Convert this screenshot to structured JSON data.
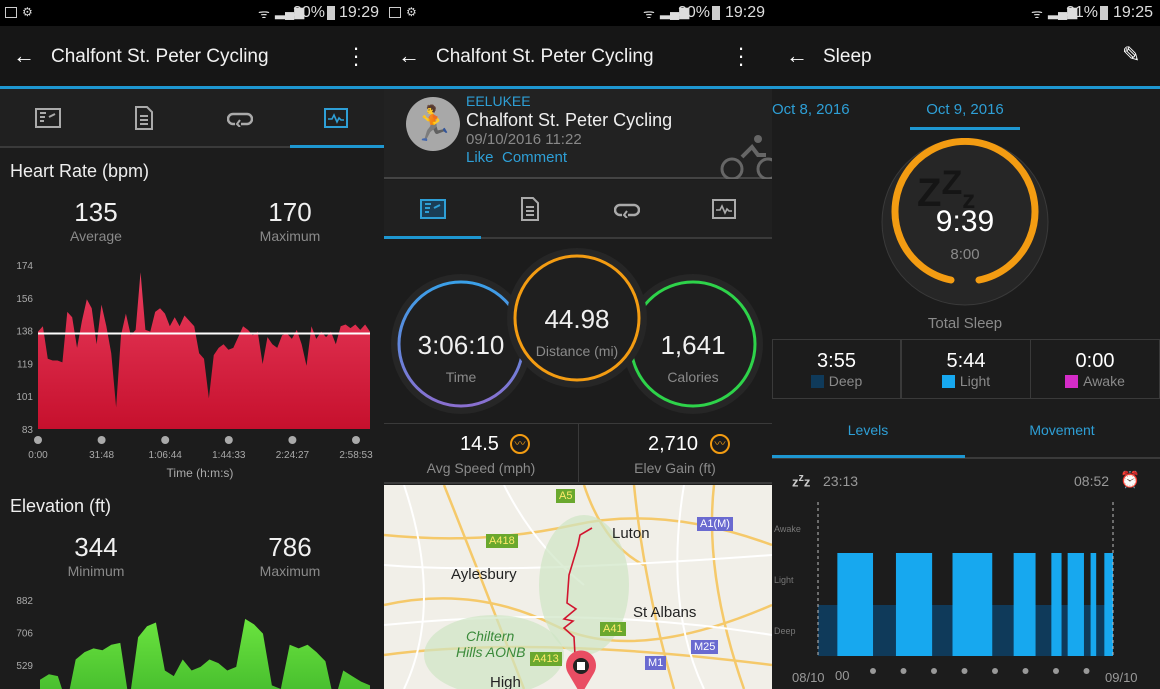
{
  "panel1": {
    "status": {
      "battery": "30%",
      "time": "19:29"
    },
    "title": "Chalfont St. Peter Cycling",
    "tabs": [
      "overview-icon",
      "details-icon",
      "laps-icon",
      "charts-icon"
    ],
    "active_tab": 3,
    "heart": {
      "heading": "Heart Rate (bpm)",
      "avg_value": "135",
      "avg_label": "Average",
      "max_value": "170",
      "max_label": "Maximum"
    },
    "elevation": {
      "heading": "Elevation (ft)",
      "min_value": "344",
      "min_label": "Minimum",
      "max_value": "786",
      "max_label": "Maximum"
    }
  },
  "panel2": {
    "status": {
      "battery": "30%",
      "time": "19:29"
    },
    "title": "Chalfont St. Peter Cycling",
    "user": "EELUKEE",
    "activity": "Chalfont St. Peter Cycling",
    "datetime": "09/10/2016 11:22",
    "like": "Like",
    "comment": "Comment",
    "active_tab": 0,
    "time_value": "3:06:10",
    "time_label": "Time",
    "distance_value": "44.98",
    "distance_label": "Distance (mi)",
    "calories_value": "1,641",
    "calories_label": "Calories",
    "speed_value": "14.5",
    "speed_label": "Avg Speed (mph)",
    "elev_value": "2,710",
    "elev_label": "Elev Gain (ft)",
    "map": {
      "places": [
        "Luton",
        "Aylesbury",
        "St Albans",
        "Chiltern",
        "Hills AONB",
        "High"
      ],
      "roads": [
        "A5",
        "A418",
        "A1(M)",
        "A41",
        "M25",
        "A413",
        "M1"
      ]
    }
  },
  "panel3": {
    "status": {
      "battery": "31%",
      "time": "19:25"
    },
    "title": "Sleep",
    "date_prev": "Oct 8, 2016",
    "date_current": "Oct 9, 2016",
    "total": "9:39",
    "goal": "8:00",
    "total_label": "Total Sleep",
    "deep_value": "3:55",
    "deep_label": "Deep",
    "light_value": "5:44",
    "light_label": "Light",
    "awake_value": "0:00",
    "awake_label": "Awake",
    "tab_levels": "Levels",
    "tab_movement": "Movement",
    "sleep_start": "23:13",
    "sleep_end": "08:52",
    "axis_start": "08/10",
    "axis_mid": "00",
    "axis_end": "09/10"
  },
  "colors": {
    "accent": "#1e97d1",
    "heart": "#e0294f",
    "elevation": "#5fd93a",
    "orange": "#f39c12",
    "deep": "#0f3a5a",
    "light": "#17a8ef",
    "awake": "#d52cc8"
  },
  "chart_data": [
    {
      "type": "area",
      "title": "Heart Rate (bpm)",
      "xlabel": "Time (h:m:s)",
      "ylim": [
        83,
        174
      ],
      "yticks": [
        "174",
        "156",
        "138",
        "119",
        "101",
        "83"
      ],
      "xticks": [
        "0:00",
        "31:48",
        "1:06:44",
        "1:44:33",
        "2:24:27",
        "2:58:53"
      ],
      "average": 136,
      "values": [
        137,
        140,
        122,
        121,
        121,
        120,
        148,
        145,
        128,
        143,
        155,
        150,
        130,
        152,
        140,
        125,
        95,
        135,
        147,
        135,
        138,
        170,
        138,
        137,
        148,
        150,
        147,
        140,
        145,
        140,
        146,
        143,
        140,
        125,
        122,
        100,
        124,
        128,
        130,
        127,
        128,
        134,
        140,
        138,
        135,
        137,
        119,
        134,
        130,
        128,
        135,
        136,
        133,
        138,
        130,
        118,
        140,
        133,
        137,
        134,
        137,
        130,
        140,
        141,
        139,
        141,
        138,
        141,
        137
      ]
    },
    {
      "type": "area",
      "title": "Elevation (ft)",
      "yticks": [
        "882",
        "706",
        "529"
      ],
      "values": [
        450,
        480,
        470,
        320,
        560,
        600,
        620,
        610,
        640,
        650,
        330,
        680,
        740,
        760,
        500,
        470,
        560,
        500,
        520,
        560,
        540,
        500,
        520,
        780,
        750,
        700,
        420,
        400,
        640,
        620,
        640,
        600,
        550,
        330,
        500,
        470,
        440,
        420
      ]
    },
    {
      "type": "bar",
      "title": "Levels",
      "levels": [
        "Awake",
        "Light",
        "Deep"
      ],
      "start": "23:13",
      "end": "08:52",
      "light_segments": [
        [
          "23:51",
          "01:01"
        ],
        [
          "01:46",
          "02:57"
        ],
        [
          "03:37",
          "04:55"
        ],
        [
          "05:37",
          "06:20"
        ],
        [
          "06:51",
          "07:11"
        ],
        [
          "07:23",
          "07:55"
        ],
        [
          "08:08",
          "08:19"
        ],
        [
          "08:35",
          "08:52"
        ]
      ]
    }
  ]
}
